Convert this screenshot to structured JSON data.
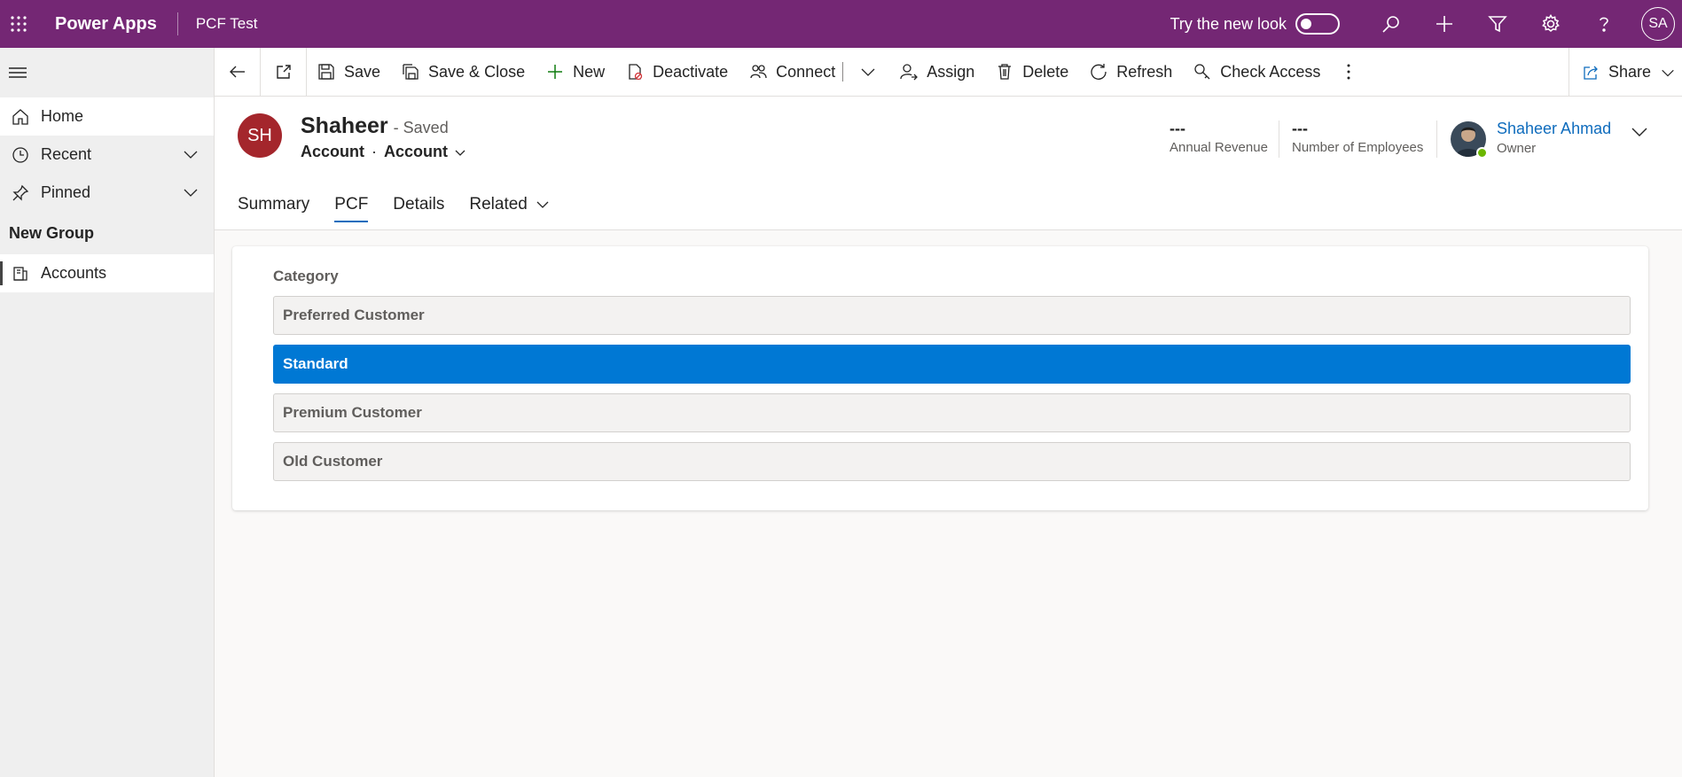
{
  "appbar": {
    "app_name": "Power Apps",
    "environment": "PCF Test",
    "try_new_look": "Try the new look",
    "user_initials": "SA",
    "color": "#742774"
  },
  "nav": {
    "home": "Home",
    "recent": "Recent",
    "pinned": "Pinned",
    "group_label": "New Group",
    "accounts": "Accounts"
  },
  "commands": {
    "save": "Save",
    "save_close": "Save & Close",
    "new": "New",
    "deactivate": "Deactivate",
    "connect": "Connect",
    "assign": "Assign",
    "delete": "Delete",
    "refresh": "Refresh",
    "check_access": "Check Access",
    "share": "Share"
  },
  "record": {
    "initials": "SH",
    "name": "Shaheer",
    "status": "- Saved",
    "entity": "Account",
    "form": "Account",
    "avatar_color": "#a4262c"
  },
  "header_fields": {
    "annual_revenue_value": "---",
    "annual_revenue_label": "Annual Revenue",
    "employees_value": "---",
    "employees_label": "Number of Employees",
    "owner_name": "Shaheer Ahmad",
    "owner_label": "Owner"
  },
  "tabs": {
    "summary": "Summary",
    "pcf": "PCF",
    "details": "Details",
    "related": "Related"
  },
  "category": {
    "label": "Category",
    "options": [
      "Preferred Customer",
      "Standard",
      "Premium Customer",
      "Old Customer"
    ],
    "selected": "Standard",
    "selected_color": "#0078d4"
  }
}
